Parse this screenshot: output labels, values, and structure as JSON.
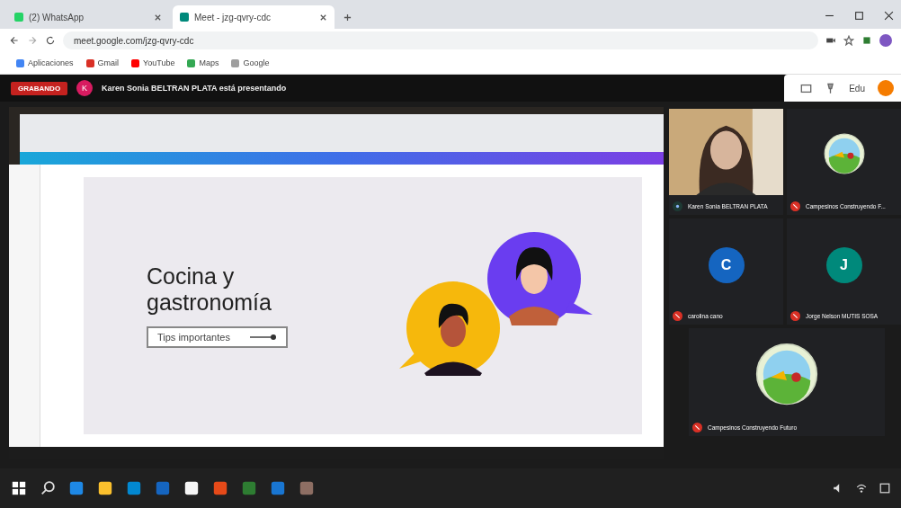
{
  "browser": {
    "tabs": [
      {
        "title": "(2) WhatsApp",
        "selected": false
      },
      {
        "title": "Meet - jzg-qvry-cdc",
        "selected": true
      }
    ],
    "url": "meet.google.com/jzg-qvry-cdc",
    "bookmarks": [
      "Aplicaciones",
      "Gmail",
      "YouTube",
      "Maps",
      "Google"
    ]
  },
  "meet": {
    "recording_label": "GRABANDO",
    "presenter_initial": "K",
    "presenting_text": "Karen Sonia BELTRAN PLATA está presentando",
    "user_name": "Edu"
  },
  "slide": {
    "title": "Cocina y gastronomía",
    "button": "Tips importantes"
  },
  "participants": [
    {
      "name": "Karen Sonia BELTRAN PLATA",
      "kind": "video",
      "muted": false
    },
    {
      "name": "Campesinos Construyendo F...",
      "kind": "logo",
      "muted": true
    },
    {
      "name": "carolina cano",
      "kind": "initial",
      "initial": "C",
      "color": "#1565c0",
      "muted": true
    },
    {
      "name": "Jorge Nelson MUTIS SOSA",
      "kind": "initial",
      "initial": "J",
      "color": "#00897b",
      "muted": true
    },
    {
      "name": "Campesinos Construyendo Futuro",
      "kind": "logo",
      "muted": true
    }
  ]
}
